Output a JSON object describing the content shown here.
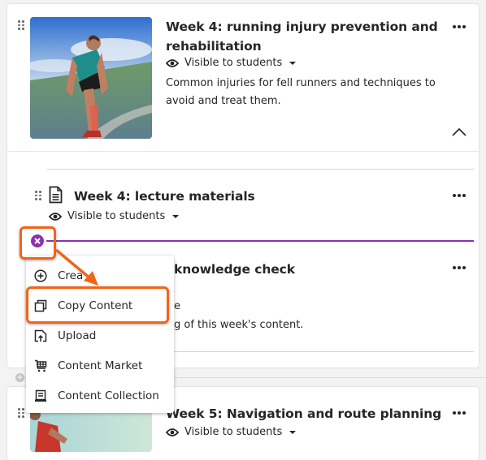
{
  "colors": {
    "accent_purple": "#8f2fb0",
    "callout_orange": "#f26418",
    "text": "#262626"
  },
  "modules": [
    {
      "title_line1": "Week 4: running injury prevention and",
      "title_line2": "rehabilitation",
      "visibility": "Visible to students",
      "description_line1": "Common injuries for fell runners and techniques to",
      "description_line2": "avoid and treat them.",
      "expanded": true,
      "items": [
        {
          "type": "document",
          "title": "Week 4: lecture materials",
          "visibility": "Visible to students"
        },
        {
          "type": "test",
          "title_partial": "knowledge check",
          "visibility_partial": "e",
          "description_partial": "g of this week's content."
        }
      ]
    },
    {
      "title": "Week 5: Navigation and route planning",
      "visibility": "Visible to students"
    }
  ],
  "add_menu": {
    "items": [
      {
        "label": "Create",
        "visible_label": "Crea",
        "icon": "plus-circle-icon"
      },
      {
        "label": "Copy Content",
        "icon": "copy-icon",
        "highlighted": true
      },
      {
        "label": "Upload",
        "icon": "upload-icon"
      },
      {
        "label": "Content Market",
        "icon": "cart-icon"
      },
      {
        "label": "Content Collection",
        "icon": "collection-icon"
      }
    ]
  }
}
